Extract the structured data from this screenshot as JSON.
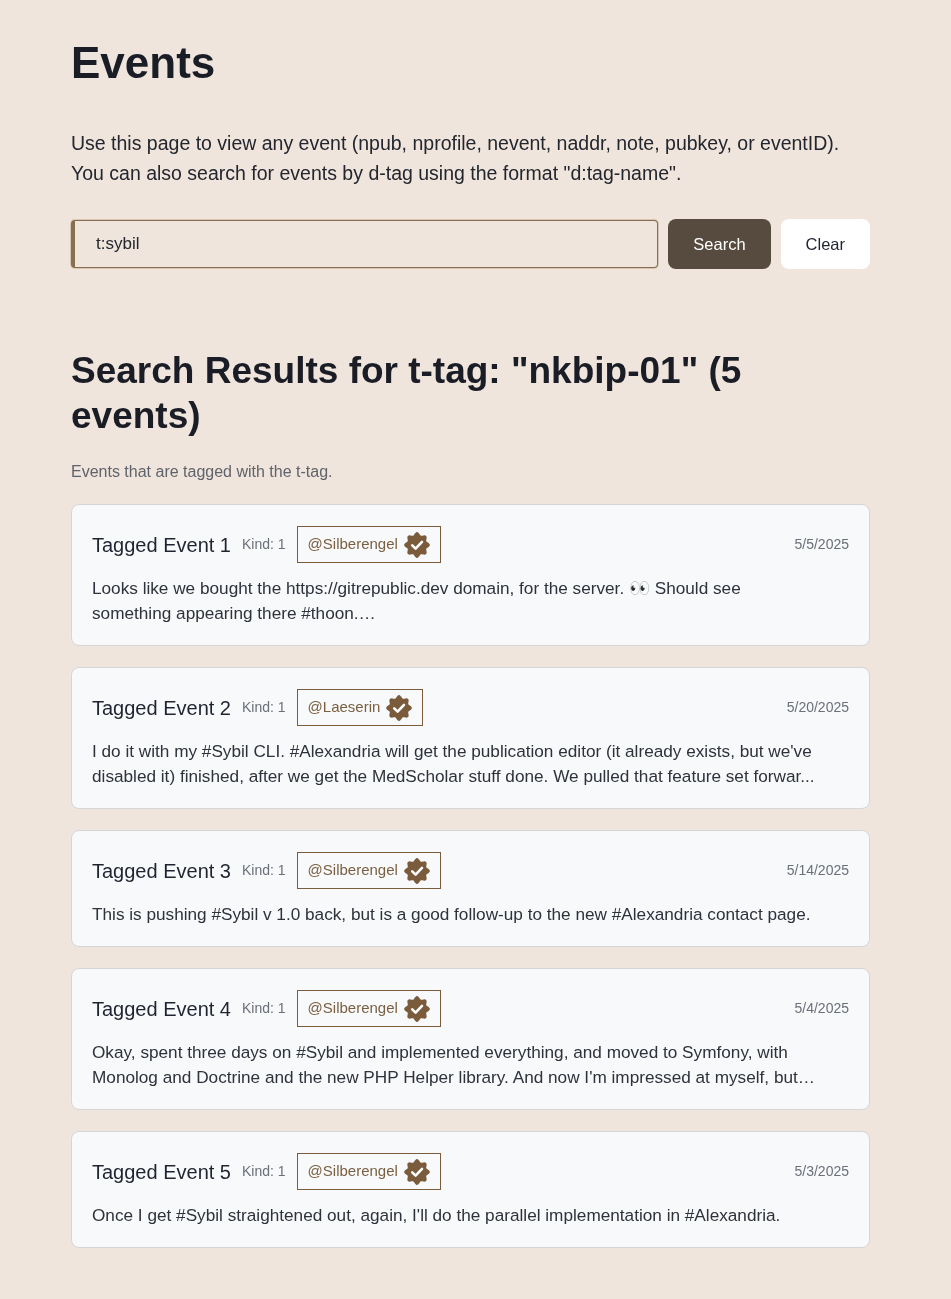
{
  "page": {
    "title": "Events",
    "description": "Use this page to view any event (npub, nprofile, nevent, naddr, note, pubkey, or eventID). You can also search for events by d-tag using the format \"d:tag-name\"."
  },
  "search": {
    "value": "t:sybil",
    "buttons": [
      {
        "label": "Search",
        "kind": "primary"
      },
      {
        "label": "Clear",
        "kind": "secondary"
      }
    ]
  },
  "results": {
    "heading": "Search Results for t-tag: \"nkbip-01\" (5 events)",
    "subtitle": "Events that are tagged with the t-tag.",
    "events": [
      {
        "title": "Tagged Event 1",
        "kind": "Kind: 1",
        "author": "@Silberengel",
        "verified": true,
        "date": "5/5/2025",
        "content": "Looks like we bought the https://gitrepublic.dev domain, for the server. 👀 Should see something appearing there #thoon.…"
      },
      {
        "title": "Tagged Event 2",
        "kind": "Kind: 1",
        "author": "@Laeserin",
        "verified": true,
        "date": "5/20/2025",
        "content": "I do it with my #Sybil CLI. #Alexandria will get the publication editor (it already exists, but we've disabled it) finished, after we get the MedScholar stuff done. We pulled that feature set forwar..."
      },
      {
        "title": "Tagged Event 3",
        "kind": "Kind: 1",
        "author": "@Silberengel",
        "verified": true,
        "date": "5/14/2025",
        "content": "This is pushing #Sybil v 1.0 back, but is a good follow-up to the new #Alexandria contact page."
      },
      {
        "title": "Tagged Event 4",
        "kind": "Kind: 1",
        "author": "@Silberengel",
        "verified": true,
        "date": "5/4/2025",
        "content": "Okay, spent three days on #Sybil and implemented everything, and moved to Symfony, with Monolog and Doctrine and the new PHP Helper library. And now I'm impressed at myself, but…"
      },
      {
        "title": "Tagged Event 5",
        "kind": "Kind: 1",
        "author": "@Silberengel",
        "verified": true,
        "date": "5/3/2025",
        "content": "Once I get #Sybil straightened out, again, I'll do the parallel implementation in #Alexandria."
      }
    ]
  }
}
